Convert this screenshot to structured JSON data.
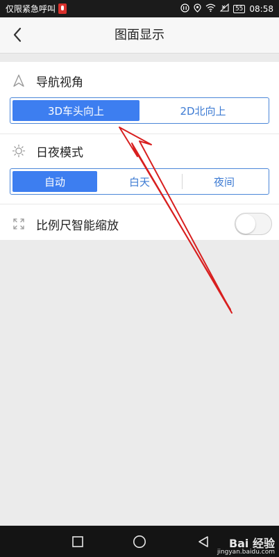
{
  "status_bar": {
    "carrier_text": "仅限紧急呼叫",
    "battery": "55",
    "time": "08:58"
  },
  "header": {
    "title": "图面显示"
  },
  "sections": {
    "nav_view": {
      "title": "导航视角",
      "icon": "navigation-arrow-icon",
      "options": [
        "3D车头向上",
        "2D北向上"
      ],
      "selected": "3D车头向上"
    },
    "day_night": {
      "title": "日夜模式",
      "icon": "sun-icon",
      "options": [
        "自动",
        "白天",
        "夜间"
      ],
      "selected": "自动"
    },
    "scale": {
      "title": "比例尺智能缩放",
      "icon": "expand-icon",
      "toggle_on": false
    }
  },
  "watermark": {
    "main": "Bai 经验",
    "sub": "jingyan.baidu.com"
  },
  "colors": {
    "accent": "#3d7ef0",
    "annotation": "#d81f1f"
  }
}
